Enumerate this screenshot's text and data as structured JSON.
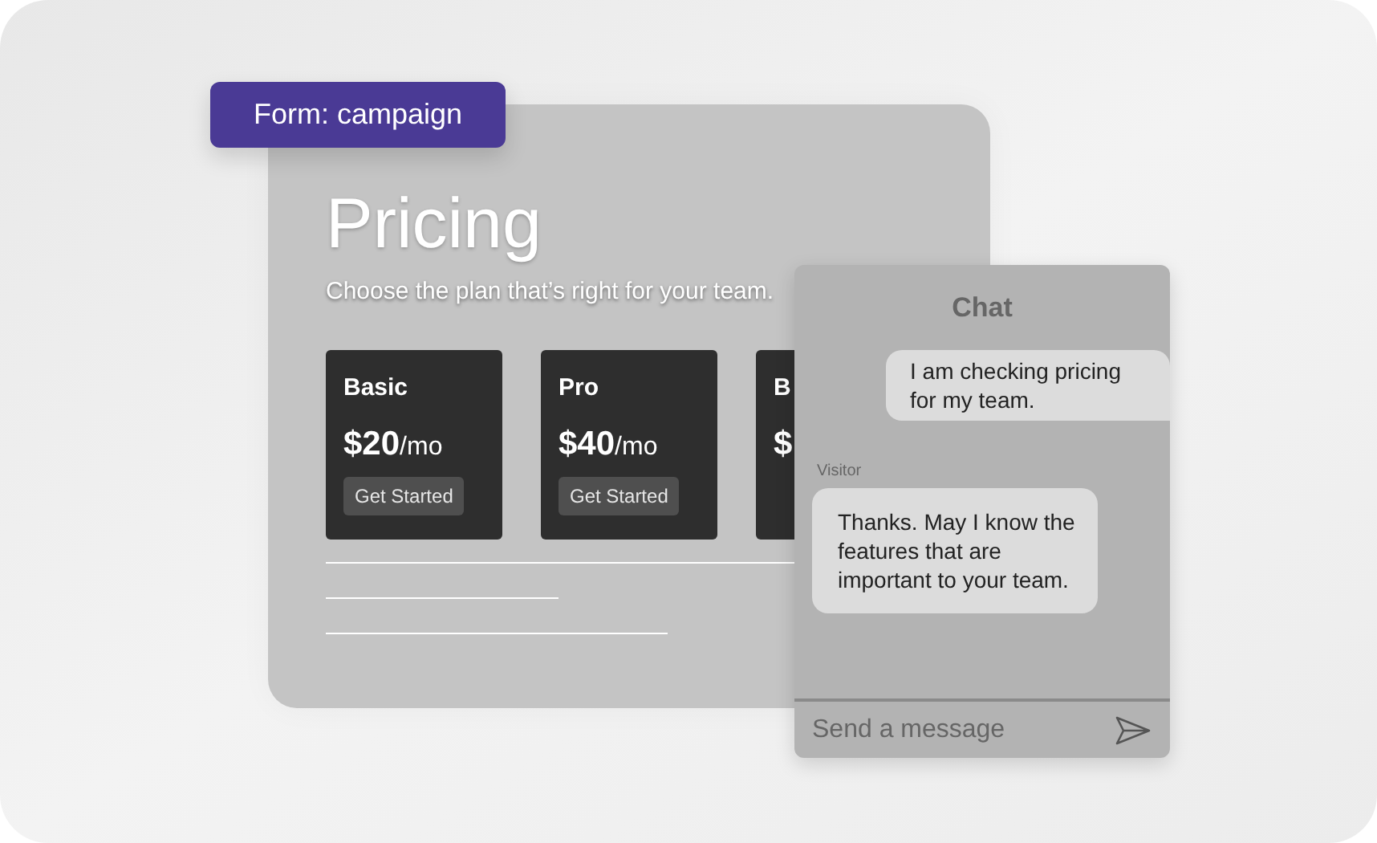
{
  "badge": {
    "label": "Form: campaign"
  },
  "pricing": {
    "title": "Pricing",
    "subtitle": "Choose the plan that’s right for your team.",
    "plans": [
      {
        "name": "Basic",
        "price": "$20",
        "period": "/mo",
        "button": "Get Started"
      },
      {
        "name": "Pro",
        "price": "$40",
        "period": "/mo",
        "button": "Get Started"
      },
      {
        "name": "B",
        "price": "$"
      }
    ]
  },
  "chat": {
    "title": "Chat",
    "messages": [
      {
        "kind": "outgoing",
        "text": "I am checking pricing for my team."
      },
      {
        "kind": "incoming",
        "sender": "Visitor",
        "text": "Thanks. May I know the features that are important to your team."
      }
    ],
    "input": {
      "placeholder": "Send a message"
    }
  }
}
